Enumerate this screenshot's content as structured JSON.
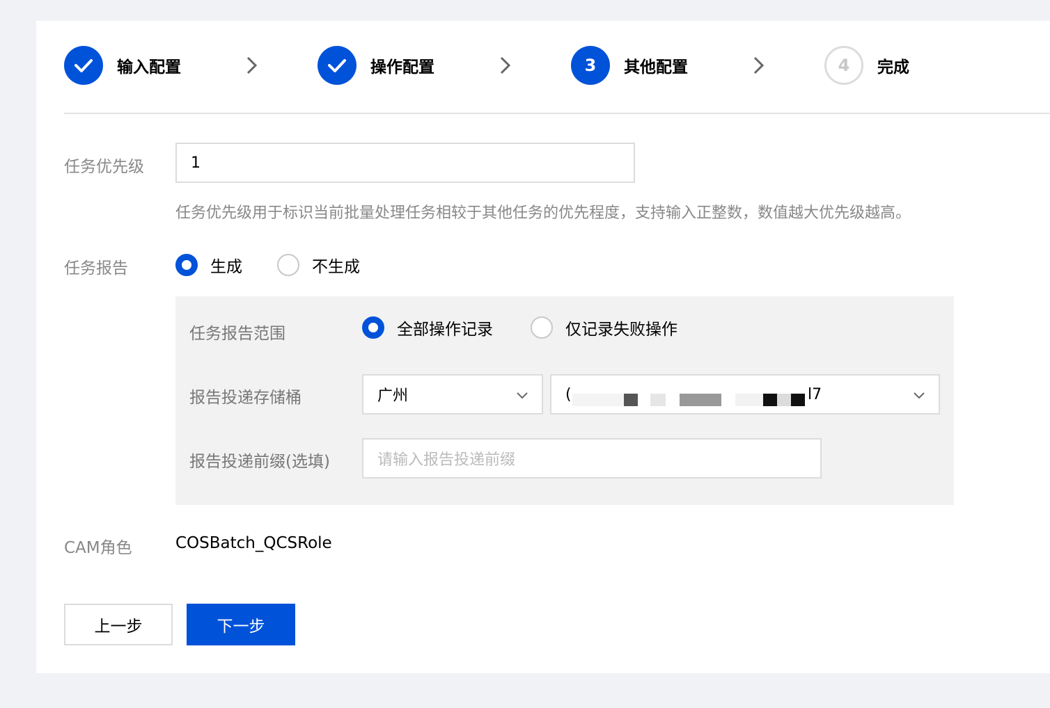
{
  "steps": [
    {
      "label": "输入配置",
      "status": "done"
    },
    {
      "label": "操作配置",
      "status": "done"
    },
    {
      "label": "其他配置",
      "status": "current",
      "number": "3"
    },
    {
      "label": "完成",
      "status": "pending",
      "number": "4"
    }
  ],
  "priority": {
    "label": "任务优先级",
    "value": "1",
    "help": "任务优先级用于标识当前批量处理任务相较于其他任务的优先程度，支持输入正整数，数值越大优先级越高。"
  },
  "report": {
    "label": "任务报告",
    "options": [
      {
        "label": "生成",
        "selected": true
      },
      {
        "label": "不生成",
        "selected": false
      }
    ],
    "scope": {
      "label": "任务报告范围",
      "options": [
        {
          "label": "全部操作记录",
          "selected": true
        },
        {
          "label": "仅记录失败操作",
          "selected": false
        }
      ]
    },
    "bucket": {
      "label": "报告投递存储桶",
      "region": "广州",
      "bucket_prefix_visible": "(",
      "bucket_suffix_visible": "l7"
    },
    "prefix": {
      "label": "报告投递前缀(选填)",
      "placeholder": "请输入报告投递前缀"
    }
  },
  "cam": {
    "label": "CAM角色",
    "value": "COSBatch_QCSRole"
  },
  "buttons": {
    "prev": "上一步",
    "next": "下一步"
  },
  "colors": {
    "primary": "#0052d9",
    "page_bg": "#f0f2f5",
    "panel_bg": "#f2f2f2"
  }
}
